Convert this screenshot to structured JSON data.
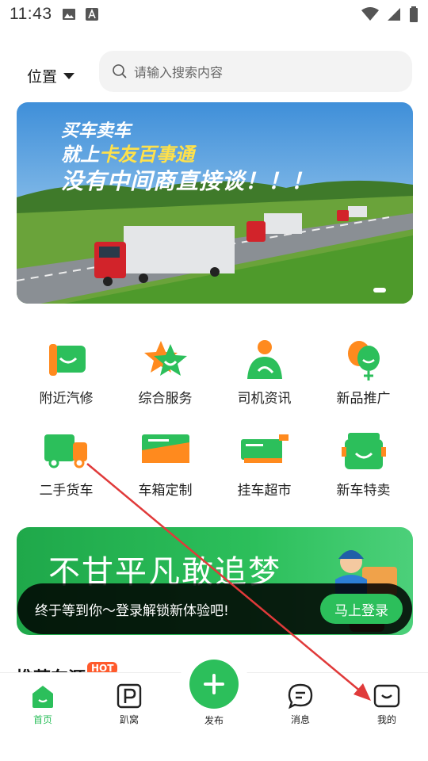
{
  "status_bar": {
    "time": "11:43"
  },
  "header": {
    "location_label": "位置",
    "search_placeholder": "请输入搜索内容"
  },
  "banner": {
    "line1": "买车卖车",
    "line2_prefix": "就上",
    "line2_highlight": "卡友百事通",
    "line3": "没有中间商直接谈！！！"
  },
  "services": [
    {
      "label": "附近汽修",
      "icon": "wrench-truck-icon"
    },
    {
      "label": "综合服务",
      "icon": "star-face-icon"
    },
    {
      "label": "司机资讯",
      "icon": "driver-icon"
    },
    {
      "label": "新品推广",
      "icon": "balloon-icon"
    },
    {
      "label": "二手货车",
      "icon": "cargo-truck-icon"
    },
    {
      "label": "车箱定制",
      "icon": "container-icon"
    },
    {
      "label": "挂车超市",
      "icon": "trailer-icon"
    },
    {
      "label": "新车特卖",
      "icon": "new-truck-icon"
    }
  ],
  "promo": {
    "slogan": "不甘平凡敢追梦"
  },
  "toast": {
    "message": "终于等到你～登录解锁新体验吧!",
    "button": "马上登录"
  },
  "section": {
    "title": "推荐车源",
    "badge": "HOT"
  },
  "tabbar": {
    "home": "首页",
    "park": "趴窝",
    "publish": "发布",
    "messages": "消息",
    "mine": "我的"
  },
  "colors": {
    "accent": "#2cbf5b",
    "orange": "#ff8a1e",
    "hot": "#ff5a2c"
  }
}
